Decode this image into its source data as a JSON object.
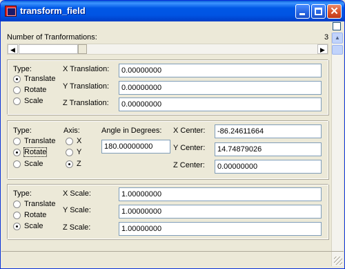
{
  "window": {
    "title": "transform_field",
    "close_glyph": "✕",
    "icons": {
      "app": "app-icon",
      "minimize": "minimize-icon",
      "maximize": "maximize-icon",
      "close": "close-icon"
    }
  },
  "header": {
    "num_transformations_label": "Number of Tranformations:",
    "num_transformations_value": "3",
    "slider_fraction": 0.2,
    "left_arrow": "◀",
    "right_arrow": "▶"
  },
  "scrollbar": {
    "up_arrow": "▲"
  },
  "panels": [
    {
      "type_label": "Type:",
      "options": [
        {
          "label": "Translate",
          "selected": true
        },
        {
          "label": "Rotate",
          "selected": false
        },
        {
          "label": "Scale",
          "selected": false
        }
      ],
      "fields": [
        {
          "label": "X Translation:",
          "value": "0.00000000"
        },
        {
          "label": "Y Translation:",
          "value": "0.00000000"
        },
        {
          "label": "Z Translation:",
          "value": "0.00000000"
        }
      ]
    },
    {
      "type_label": "Type:",
      "options": [
        {
          "label": "Translate",
          "selected": false
        },
        {
          "label": "Rotate",
          "selected": true
        },
        {
          "label": "Scale",
          "selected": false
        }
      ],
      "axis_label": "Axis:",
      "axes": [
        {
          "label": "X",
          "selected": false
        },
        {
          "label": "Y",
          "selected": false
        },
        {
          "label": "Z",
          "selected": true
        }
      ],
      "angle_label": "Angle in Degrees:",
      "angle_value": "180.00000000",
      "centers": [
        {
          "label": "X Center:",
          "value": "-86.24611664"
        },
        {
          "label": "Y Center:",
          "value": "14.74879026"
        },
        {
          "label": "Z Center:",
          "value": "0.00000000"
        }
      ]
    },
    {
      "type_label": "Type:",
      "options": [
        {
          "label": "Translate",
          "selected": false
        },
        {
          "label": "Rotate",
          "selected": false
        },
        {
          "label": "Scale",
          "selected": true
        }
      ],
      "fields": [
        {
          "label": "X Scale:",
          "value": "1.00000000"
        },
        {
          "label": "Y Scale:",
          "value": "1.00000000"
        },
        {
          "label": "Z Scale:",
          "value": "1.00000000"
        }
      ]
    }
  ]
}
